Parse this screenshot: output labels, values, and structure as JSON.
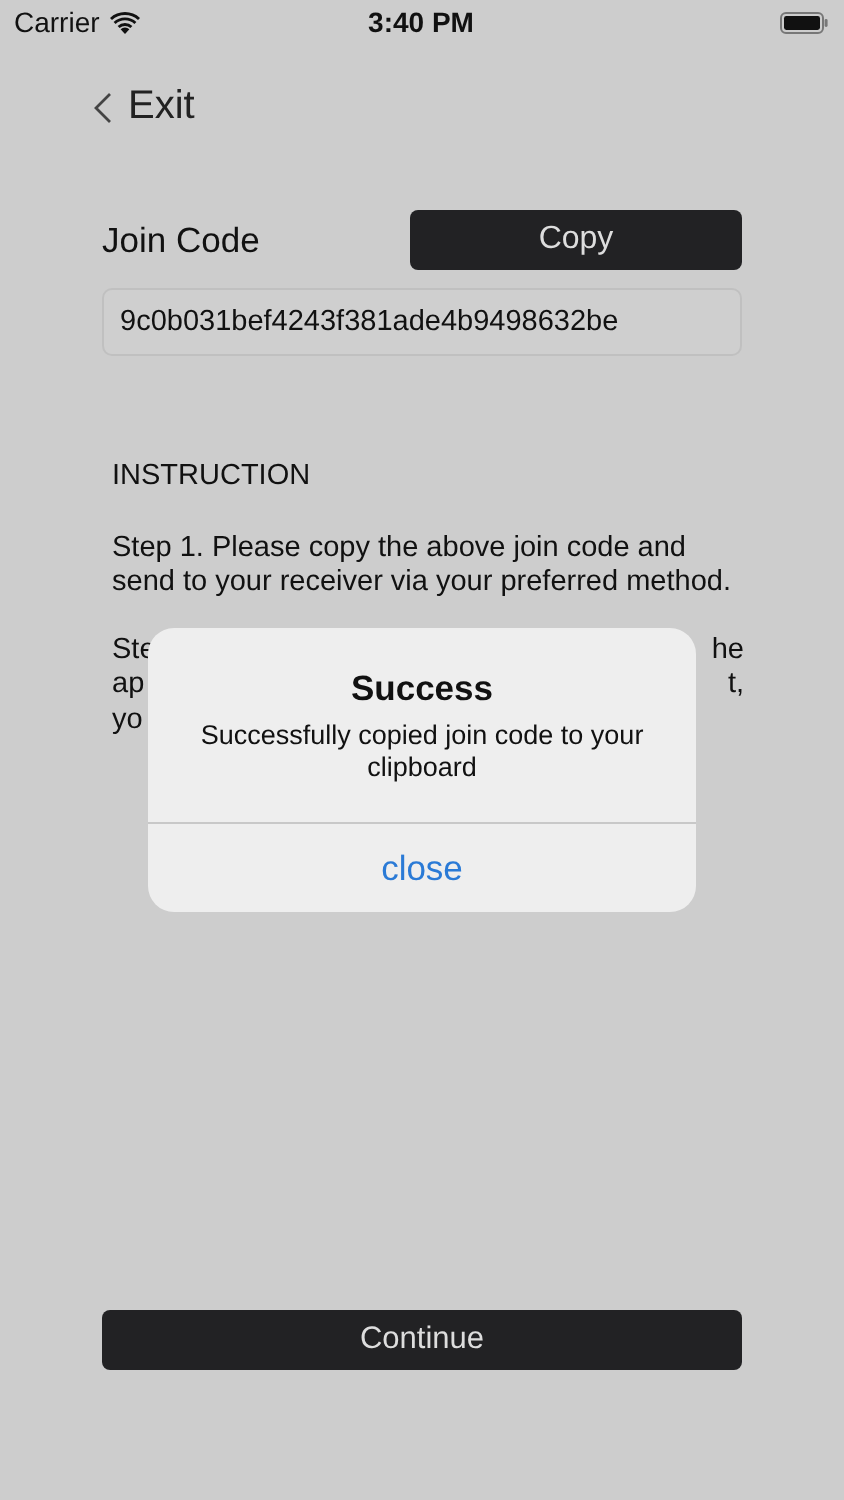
{
  "status_bar": {
    "carrier": "Carrier",
    "time": "3:40 PM"
  },
  "nav": {
    "back_label": "Exit"
  },
  "join_code": {
    "label": "Join Code",
    "copy_button": "Copy",
    "value": "9c0b031bef4243f381ade4b9498632be"
  },
  "instruction": {
    "heading": "INSTRUCTION",
    "step_1": "Step 1. Please copy the above join code and send to your receiver via your preferred method.",
    "step_2_visible_fragments": [
      {
        "left": "Ste",
        "right": "he"
      },
      {
        "left": "ap",
        "right": "t,"
      },
      {
        "left": "yo"
      }
    ]
  },
  "alert": {
    "title": "Success",
    "message": "Successfully copied join code to your clipboard",
    "button": "close"
  },
  "continue_button": "Continue"
}
